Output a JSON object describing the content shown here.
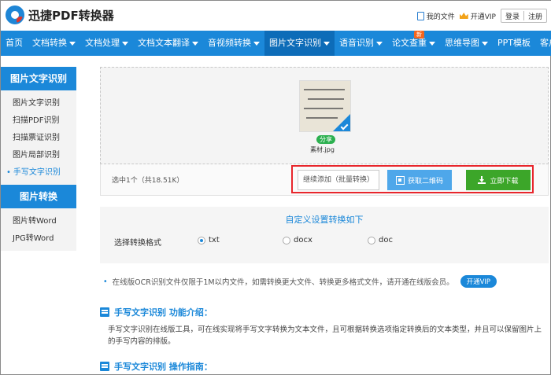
{
  "header": {
    "logo_text": "迅捷PDF转换器",
    "my_files": "我的文件",
    "open_vip": "开通VIP",
    "login": "登录",
    "register": "注册"
  },
  "nav": {
    "items": [
      {
        "label": "首页",
        "dropdown": false
      },
      {
        "label": "文档转换",
        "dropdown": true
      },
      {
        "label": "文档处理",
        "dropdown": true
      },
      {
        "label": "文档文本翻译",
        "dropdown": true
      },
      {
        "label": "音视频转换",
        "dropdown": true
      },
      {
        "label": "图片文字识别",
        "dropdown": true,
        "active": true
      },
      {
        "label": "语音识别",
        "dropdown": true
      },
      {
        "label": "论文查重",
        "dropdown": true,
        "badge": "新"
      },
      {
        "label": "思维导图",
        "dropdown": true
      },
      {
        "label": "PPT模板",
        "dropdown": false
      },
      {
        "label": "客户端",
        "dropdown": true
      }
    ]
  },
  "sidebar": {
    "section1_title": "图片文字识别",
    "section1_items": [
      "图片文字识别",
      "扫描PDF识别",
      "扫描票证识别",
      "图片局部识别",
      "手写文字识别"
    ],
    "active_item": "手写文字识别",
    "section2_title": "图片转换",
    "section2_items": [
      "图片转Word",
      "JPG转Word"
    ]
  },
  "upload": {
    "share_label": "分享",
    "file_name": "素材.jpg",
    "selection_info": "选中1个（共18.51K）",
    "btn_add": "继续添加（批量转换）",
    "btn_qr": "获取二维码",
    "btn_download": "立即下载"
  },
  "settings": {
    "title": "自定义设置转换如下",
    "format_label": "选择转换格式",
    "options": [
      "txt",
      "docx",
      "doc"
    ],
    "selected": "txt"
  },
  "notice": {
    "text": "在线版OCR识别文件仅限于1M以内文件，如需转换更大文件、转换更多格式文件，请开通在线版会员。",
    "btn_vip": "开通VIP"
  },
  "intro": {
    "title": "手写文字识别 功能介绍：",
    "body": "手写文字识别在线版工具，可在线实现将手写文字转换为文本文件，且可根据转换选项指定转换后的文本类型，并且可以保留图片上的手写内容的排版。",
    "guide_title": "手写文字识别 操作指南："
  },
  "colors": {
    "primary": "#1b88d9",
    "download_green": "#3ca629",
    "highlight_red": "#e8262c"
  }
}
